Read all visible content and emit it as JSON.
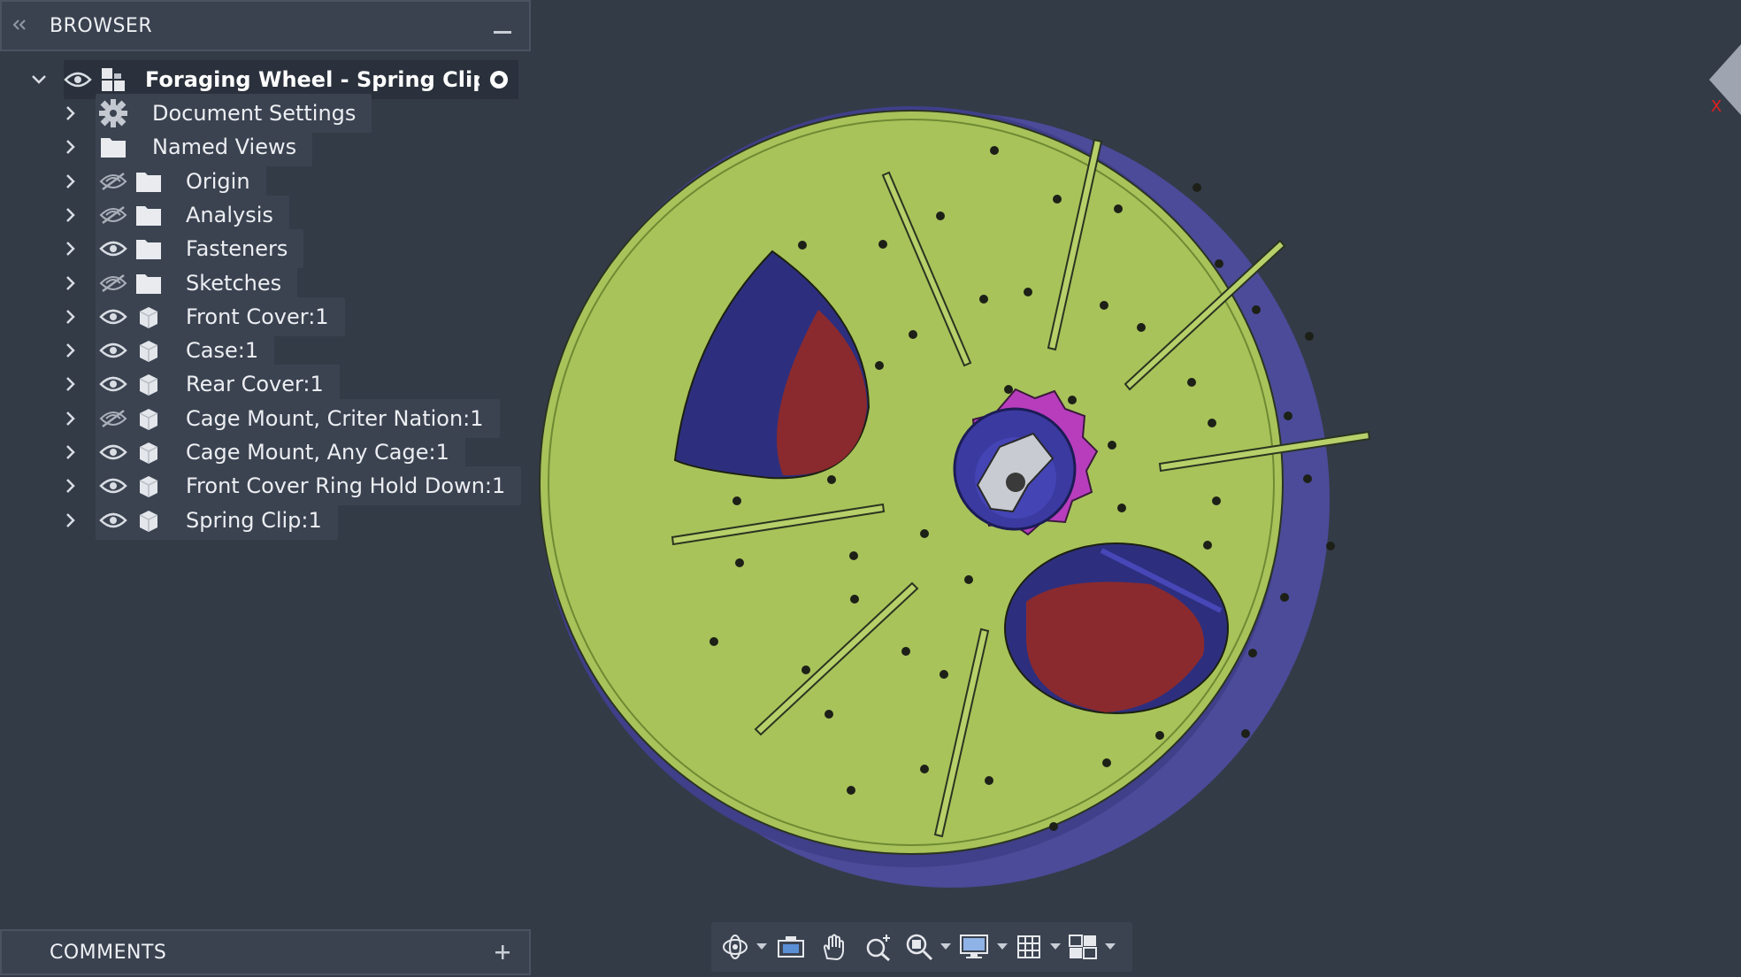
{
  "browser": {
    "title": "BROWSER",
    "collapse_icon": "double-chevron-left-icon",
    "minimize_icon": "minus-icon",
    "root": {
      "label": "Foraging Wheel - Spring Clip...",
      "icon": "assembly-icon",
      "visible": true
    },
    "items": [
      {
        "label": "Document Settings",
        "icon": "gear-icon",
        "visibility": "none"
      },
      {
        "label": "Named Views",
        "icon": "folder-icon",
        "visibility": "none"
      },
      {
        "label": "Origin",
        "icon": "folder-icon",
        "visibility": "hidden"
      },
      {
        "label": "Analysis",
        "icon": "folder-icon",
        "visibility": "hidden"
      },
      {
        "label": "Fasteners",
        "icon": "folder-icon",
        "visibility": "visible"
      },
      {
        "label": "Sketches",
        "icon": "folder-icon",
        "visibility": "hidden"
      },
      {
        "label": "Front Cover:1",
        "icon": "component-icon",
        "visibility": "visible"
      },
      {
        "label": "Case:1",
        "icon": "component-icon",
        "visibility": "visible"
      },
      {
        "label": "Rear Cover:1",
        "icon": "component-icon",
        "visibility": "visible"
      },
      {
        "label": "Cage Mount, Criter Nation:1",
        "icon": "component-icon",
        "visibility": "hidden"
      },
      {
        "label": "Cage Mount, Any Cage:1",
        "icon": "component-icon",
        "visibility": "visible"
      },
      {
        "label": "Front Cover Ring Hold Down:1",
        "icon": "component-icon",
        "visibility": "visible"
      },
      {
        "label": "Spring Clip:1",
        "icon": "component-icon",
        "visibility": "visible"
      }
    ]
  },
  "comments": {
    "title": "COMMENTS",
    "add_icon": "plus-icon"
  },
  "viewcube": {
    "axis_label": "X"
  },
  "toolbar": {
    "tools": [
      "orbit-icon",
      "look-at-icon",
      "pan-hand-icon",
      "zoom-icon",
      "fit-zoom-icon",
      "display-settings-icon",
      "grid-icon",
      "viewports-icon"
    ]
  },
  "colors": {
    "background": "#333b47",
    "panel": "#3a4250",
    "cover_green": "#a8c35a",
    "knob_magenta": "#b83dbd",
    "case_blue": "#3f3f95",
    "interior_red": "#8a2a2e"
  }
}
